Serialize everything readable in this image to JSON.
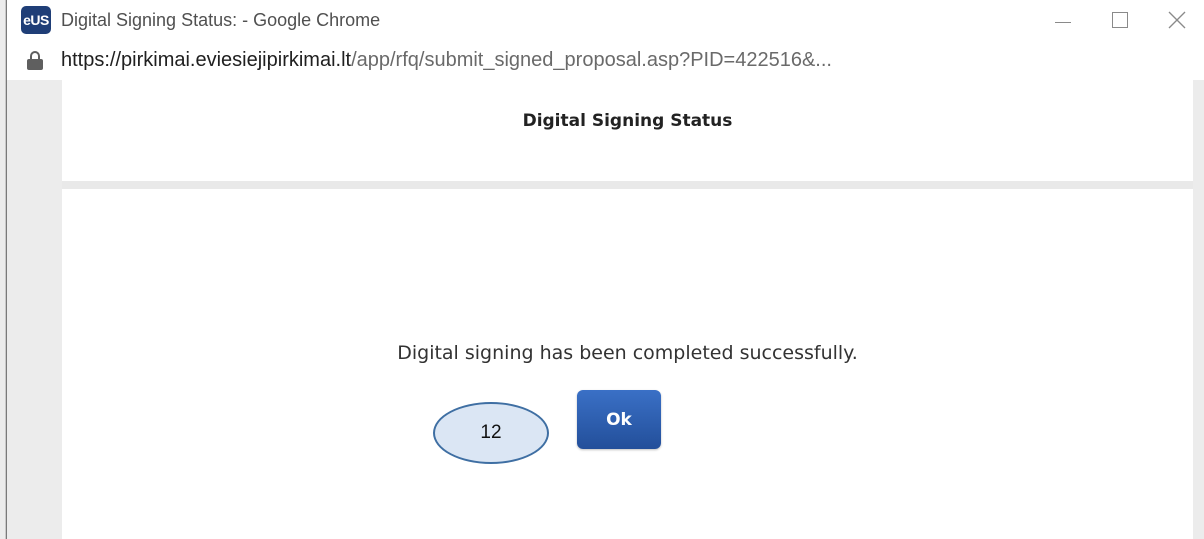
{
  "window": {
    "app_icon": "eUS",
    "title": "Digital Signing Status: - Google Chrome",
    "controls": [
      "minimize-icon",
      "maximize-icon",
      "close-icon"
    ]
  },
  "address_bar": {
    "lock_icon": "lock-icon",
    "url_host": "https://pirkimai.eviesiejipirkimai.lt",
    "url_path": "/app/rfq/submit_signed_proposal.asp?PID=422516&..."
  },
  "dialog": {
    "title": "Digital Signing Status",
    "message": "Digital signing has been completed successfully.",
    "ok_label": "Ok"
  },
  "annotation": {
    "step_number": "12"
  },
  "colors": {
    "ok_button": "#2d5fb0",
    "badge_fill": "#dbe6f4",
    "badge_border": "#3f6fa3",
    "app_icon": "#1f3e77"
  }
}
